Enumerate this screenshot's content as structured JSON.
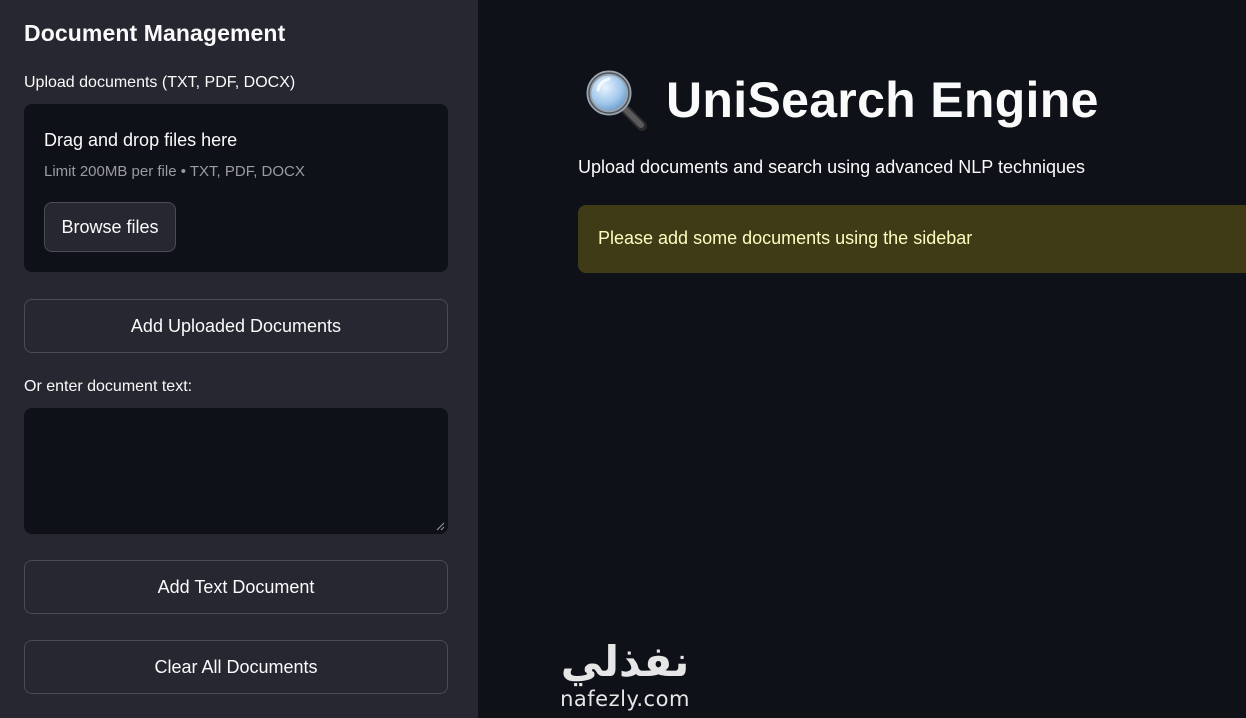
{
  "sidebar": {
    "title": "Document Management",
    "upload_label": "Upload documents (TXT, PDF, DOCX)",
    "dropzone": {
      "title": "Drag and drop files here",
      "limit": "Limit 200MB per file • TXT, PDF, DOCX",
      "browse_label": "Browse files"
    },
    "add_uploaded_label": "Add Uploaded Documents",
    "text_label": "Or enter document text:",
    "text_value": "",
    "add_text_label": "Add Text Document",
    "clear_label": "Clear All Documents"
  },
  "main": {
    "icon": "magnifying-glass-icon",
    "title": "UniSearch Engine",
    "subtitle": "Upload documents and search using advanced NLP techniques",
    "warning": "Please add some documents using the sidebar"
  },
  "watermark": {
    "arabic": "نفذلي",
    "latin": "nafezly.com"
  },
  "colors": {
    "sidebar_bg": "#262730",
    "main_bg": "#0e1117",
    "warning_bg": "#3e3b16",
    "warning_text": "#fdfdc0"
  }
}
